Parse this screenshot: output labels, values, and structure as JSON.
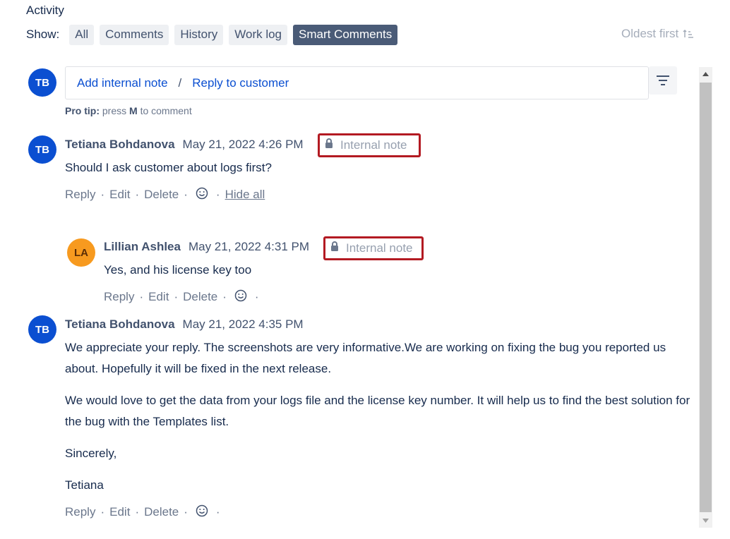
{
  "activity": {
    "title": "Activity"
  },
  "filters": {
    "show_label": "Show:",
    "buttons": [
      "All",
      "Comments",
      "History",
      "Work log",
      "Smart Comments"
    ],
    "active_index": 4
  },
  "sort": {
    "label": "Oldest first",
    "icon": "sort-ascending-icon"
  },
  "composer": {
    "avatar_initials": "TB",
    "add_internal_note": "Add internal note",
    "separator": "/",
    "reply_to_customer": "Reply to customer",
    "pro_tip_prefix": "Pro tip:",
    "pro_tip_middle": " press ",
    "pro_tip_key": "M",
    "pro_tip_suffix": " to comment"
  },
  "comments": [
    {
      "avatar": "TB",
      "author": "Tetiana Bohdanova",
      "timestamp": "May 21, 2022 4:26 PM",
      "internal_note_label": "Internal note",
      "body": [
        "Should I ask customer about logs first?"
      ],
      "actions": {
        "reply": "Reply",
        "edit": "Edit",
        "delete": "Delete",
        "hide_all": "Hide all"
      }
    },
    {
      "avatar": "LA",
      "author": "Lillian Ashlea",
      "timestamp": "May 21, 2022 4:31 PM",
      "internal_note_label": "Internal note",
      "body": [
        "Yes, and his license key too"
      ],
      "actions": {
        "reply": "Reply",
        "edit": "Edit",
        "delete": "Delete"
      }
    },
    {
      "avatar": "TB",
      "author": "Tetiana Bohdanova",
      "timestamp": "May 21, 2022 4:35 PM",
      "body": [
        "We appreciate your reply. The screenshots are very informative.We are working on fixing the bug you reported us about. Hopefully it will be fixed in the next release.",
        "We would love to get the data from your logs file and the license key number. It will help us to find the best solution for the bug with the Templates list.",
        "Sincerely,",
        "Tetiana"
      ],
      "actions": {
        "reply": "Reply",
        "edit": "Edit",
        "delete": "Delete"
      }
    }
  ],
  "colors": {
    "avatar_tb": "#0b4fd1",
    "avatar_la": "#f79a1f",
    "internal_note_border": "#b31a22",
    "active_filter": "#4a5b77",
    "link": "#0b4fd1"
  }
}
